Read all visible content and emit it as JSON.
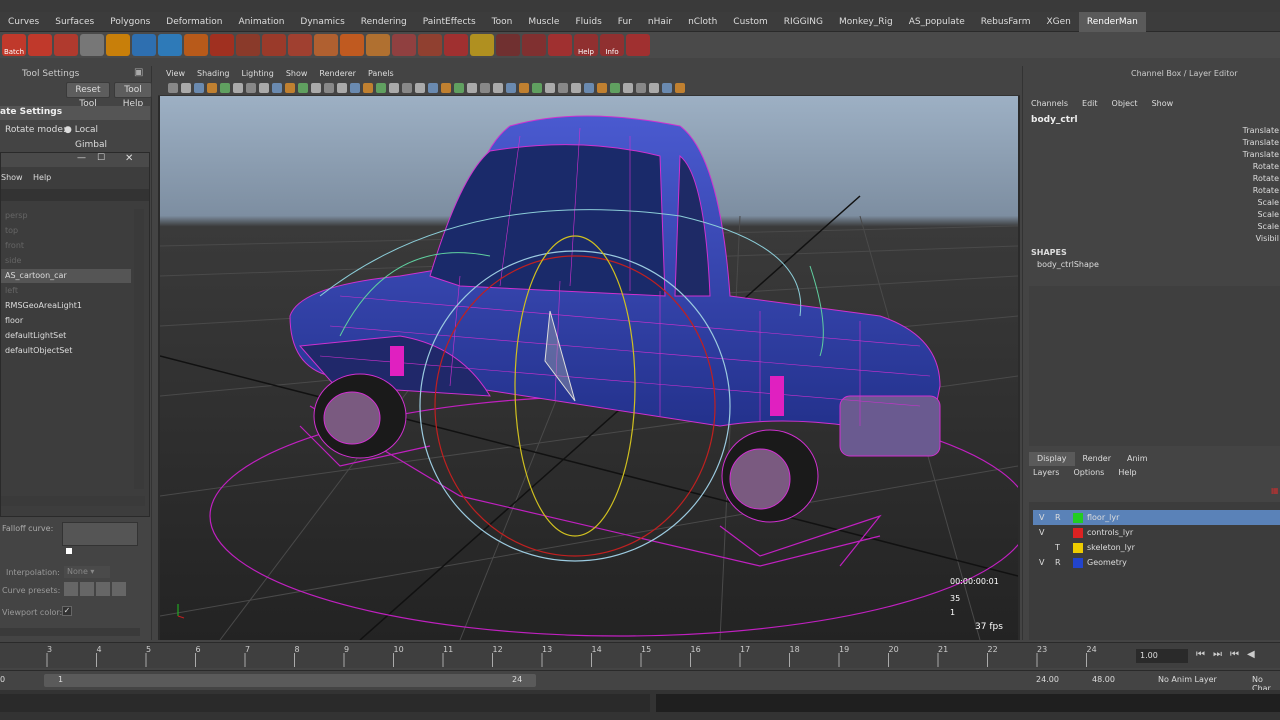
{
  "shelf_tabs": [
    "Curves",
    "Surfaces",
    "Polygons",
    "Deformation",
    "Animation",
    "Dynamics",
    "Rendering",
    "PaintEffects",
    "Toon",
    "Muscle",
    "Fluids",
    "Fur",
    "nHair",
    "nCloth",
    "Custom",
    "RIGGING",
    "Monkey_Rig",
    "AS_populate",
    "RebusFarm",
    "XGen",
    "RenderMan"
  ],
  "shelf_icons": [
    {
      "name": "batch-render-icon",
      "label": "Batch",
      "color": "#c0392b"
    },
    {
      "name": "render-icon",
      "label": "",
      "color": "#c0392b"
    },
    {
      "name": "ipr-icon",
      "label": "",
      "color": "#b03a2e"
    },
    {
      "name": "eye-icon",
      "label": "",
      "color": "#777"
    },
    {
      "name": "light-icon",
      "label": "",
      "color": "#c87f0a"
    },
    {
      "name": "globe-icon",
      "label": "",
      "color": "#2e6fb0"
    },
    {
      "name": "sphere-icon",
      "label": "",
      "color": "#2e7ab8"
    },
    {
      "name": "spotlight-icon",
      "label": "",
      "color": "#b85a1a"
    },
    {
      "name": "gear-icon",
      "label": "",
      "color": "#a03020"
    },
    {
      "name": "film-icon",
      "label": "",
      "color": "#8a3a2a"
    },
    {
      "name": "strip-icon",
      "label": "",
      "color": "#9a3a2a"
    },
    {
      "name": "brush-icon",
      "label": "",
      "color": "#a04030"
    },
    {
      "name": "tool-icon",
      "label": "",
      "color": "#b06030"
    },
    {
      "name": "flame-icon",
      "label": "",
      "color": "#c05a20"
    },
    {
      "name": "hand-icon",
      "label": "",
      "color": "#b07030"
    },
    {
      "name": "node-icon",
      "label": "",
      "color": "#904040"
    },
    {
      "name": "search-icon",
      "label": "",
      "color": "#904030"
    },
    {
      "name": "pin-icon",
      "label": "",
      "color": "#a03030"
    },
    {
      "name": "bulb-icon",
      "label": "",
      "color": "#b09020"
    },
    {
      "name": "grid-icon",
      "label": "",
      "color": "#703030"
    },
    {
      "name": "network-icon",
      "label": "",
      "color": "#803030"
    },
    {
      "name": "curve-icon",
      "label": "",
      "color": "#a03030"
    },
    {
      "name": "help-icon",
      "label": "Help",
      "color": "#903030"
    },
    {
      "name": "info-icon",
      "label": "Info",
      "color": "#903030"
    },
    {
      "name": "puzzle-icon",
      "label": "",
      "color": "#a03030"
    }
  ],
  "tool_settings": {
    "title": "Tool Settings",
    "reset": "Reset Tool",
    "help": "Tool Help",
    "section": "ate Settings",
    "rotate_mode_label": "Rotate mode:",
    "rotate_local": "Local",
    "rotate_gimbal": "Gimbal"
  },
  "outliner": {
    "menu_show": "Show",
    "menu_help": "Help",
    "items": [
      "persp",
      "top",
      "front",
      "side",
      "AS_cartoon_car",
      "left",
      "RMSGeoAreaLight1",
      "floor",
      "defaultLightSet",
      "defaultObjectSet"
    ],
    "selected_index": 4
  },
  "falloff": {
    "curve_label": "Falloff curve:",
    "interp_label": "Interpolation:",
    "interp_value": "None",
    "presets_label": "Curve presets:",
    "viewport_color_label": "Viewport color:"
  },
  "viewport": {
    "menu": [
      "View",
      "Shading",
      "Lighting",
      "Show",
      "Renderer",
      "Panels"
    ],
    "hud_time": "00:00:00:01",
    "hud_frame": "35",
    "hud_sub": "1",
    "fps": "37 fps"
  },
  "channel_box": {
    "title": "Channel Box / Layer Editor",
    "menu": [
      "Channels",
      "Edit",
      "Object",
      "Show"
    ],
    "object": "body_ctrl",
    "attrs": [
      "Translate",
      "Translate",
      "Translate",
      "Rotate",
      "Rotate",
      "Rotate",
      "Scale",
      "Scale",
      "Scale",
      "Visibil"
    ],
    "shapes_label": "SHAPES",
    "shape": "body_ctrlShape"
  },
  "layer_editor": {
    "tabs": [
      "Display",
      "Render",
      "Anim"
    ],
    "menu": [
      "Layers",
      "Options",
      "Help"
    ],
    "layers": [
      {
        "v": "V",
        "r": "R",
        "name": "floor_lyr",
        "color": "#22cc22",
        "selected": true
      },
      {
        "v": "V",
        "r": "",
        "name": "controls_lyr",
        "color": "#dd2222",
        "selected": false
      },
      {
        "v": "",
        "r": "T",
        "name": "skeleton_lyr",
        "color": "#eecc00",
        "selected": false
      },
      {
        "v": "V",
        "r": "R",
        "name": "Geometry",
        "color": "#2244cc",
        "selected": false
      }
    ]
  },
  "timeline": {
    "ticks": [
      "3",
      "4",
      "5",
      "6",
      "7",
      "8",
      "9",
      "10",
      "11",
      "12",
      "13",
      "14",
      "15",
      "16",
      "17",
      "18",
      "19",
      "20",
      "21",
      "22",
      "23",
      "24"
    ],
    "current": "1.00"
  },
  "range": {
    "start": "0",
    "inner_start": "1",
    "inner_end": "24",
    "end1": "24.00",
    "end2": "48.00",
    "anim_layer": "No Anim Layer",
    "char": "No Char"
  }
}
